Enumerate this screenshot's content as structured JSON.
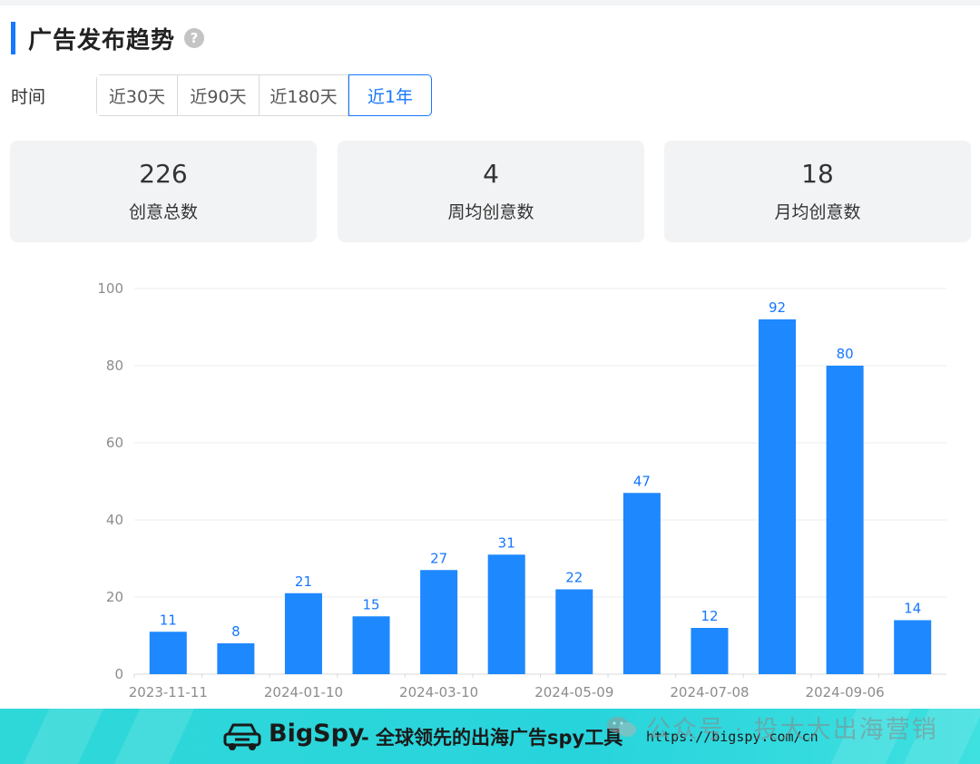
{
  "header": {
    "title": "广告发布趋势",
    "help_icon": "?"
  },
  "time_filter": {
    "label": "时间",
    "options": [
      "近30天",
      "近90天",
      "近180天",
      "近1年"
    ],
    "selected": "近1年"
  },
  "stats": [
    {
      "value": "226",
      "label": "创意总数"
    },
    {
      "value": "4",
      "label": "周均创意数"
    },
    {
      "value": "18",
      "label": "月均创意数"
    }
  ],
  "colors": {
    "accent": "#1677ff",
    "bar": "#1e88ff",
    "banner": "#2fd8d8"
  },
  "chart_data": {
    "type": "bar",
    "categories": [
      "2023-11-11",
      "",
      "2024-01-10",
      "",
      "2024-03-10",
      "",
      "2024-05-09",
      "",
      "2024-07-08",
      "",
      "2024-09-06",
      ""
    ],
    "values": [
      11,
      8,
      21,
      15,
      27,
      31,
      22,
      47,
      12,
      92,
      80,
      14
    ],
    "ylim": [
      0,
      100
    ],
    "yticks": [
      0,
      20,
      40,
      60,
      80,
      100
    ],
    "data_labels": true,
    "grid": true,
    "title": "",
    "xlabel": "",
    "ylabel": ""
  },
  "banner": {
    "brand": "BigSpy",
    "slogan": "- 全球领先的出海广告spy工具",
    "url": "https://bigspy.com/cn",
    "logo_icon": "car-icon"
  },
  "watermark": {
    "text": "公众号 · 投大大出海营销",
    "icon": "wechat-icon"
  }
}
